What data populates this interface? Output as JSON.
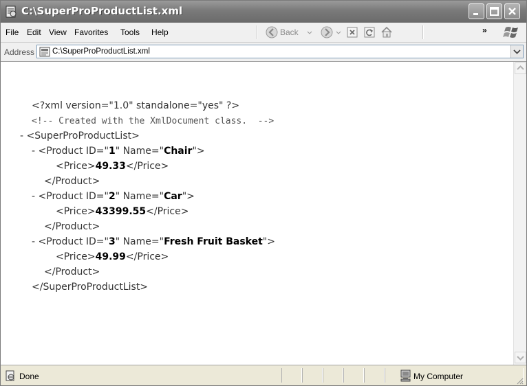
{
  "window": {
    "title": "C:\\SuperProProductList.xml"
  },
  "menu": {
    "items": [
      "File",
      "Edit",
      "View",
      "Favorites",
      "Tools",
      "Help"
    ],
    "back_label": "Back"
  },
  "toolbar": {
    "chevron": "»"
  },
  "address": {
    "label": "Address",
    "value": "C:\\SuperProProductList.xml"
  },
  "document": {
    "declaration": "<?xml version=\"1.0\" standalone=\"yes\" ?>",
    "comment": "<!-- Created with the XmlDocument class.  -->",
    "toggle": "-",
    "root_open": "<SuperProProductList>",
    "root_close": "</SuperProProductList>",
    "products": [
      {
        "id": "1",
        "name": "Chair",
        "price": "49.33"
      },
      {
        "id": "2",
        "name": "Car",
        "price": "43399.55"
      },
      {
        "id": "3",
        "name": "Fresh Fruit Basket",
        "price": "49.99"
      }
    ],
    "product_close": "</Product>"
  },
  "status": {
    "text": "Done",
    "zone": "My Computer"
  },
  "icons": [
    "ie-page-icon",
    "minimize-icon",
    "maximize-icon",
    "close-icon",
    "back-icon",
    "forward-icon",
    "stop-icon",
    "refresh-icon",
    "home-icon",
    "windows-logo-icon",
    "xml-file-icon",
    "dropdown-icon",
    "scroll-up-icon",
    "scroll-down-icon",
    "done-page-icon",
    "computer-icon"
  ],
  "colors": {
    "titlebar": "#7a7a7a",
    "chrome": "#ece9d8",
    "menubar": "#f0f0f0",
    "address_border": "#7f9db9"
  }
}
